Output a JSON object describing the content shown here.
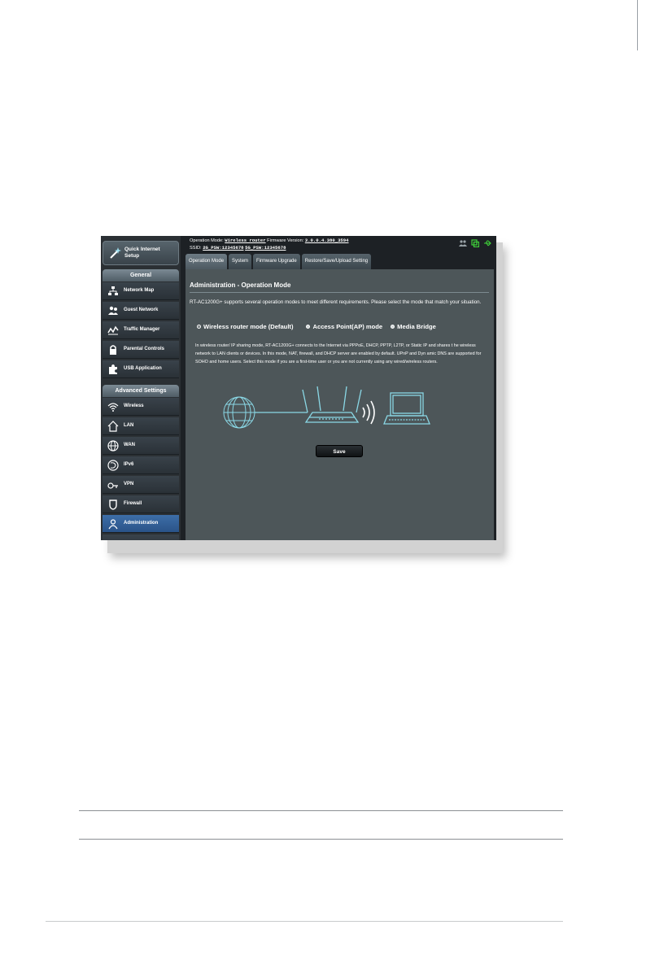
{
  "sidebar": {
    "quick_setup_label": "Quick Internet Setup",
    "general_title": "General",
    "general_items": [
      {
        "label": "Network Map",
        "icon": "network-map-icon"
      },
      {
        "label": "Guest Network",
        "icon": "guest-network-icon"
      },
      {
        "label": "Traffic Manager",
        "icon": "traffic-manager-icon"
      },
      {
        "label": "Parental Controls",
        "icon": "lock-icon"
      },
      {
        "label": "USB Application",
        "icon": "puzzle-icon"
      }
    ],
    "advanced_title": "Advanced Settings",
    "advanced_items": [
      {
        "label": "Wireless",
        "icon": "wifi-icon"
      },
      {
        "label": "LAN",
        "icon": "home-icon"
      },
      {
        "label": "WAN",
        "icon": "globe-icon"
      },
      {
        "label": "IPv6",
        "icon": "ipv6-icon"
      },
      {
        "label": "VPN",
        "icon": "vpn-icon"
      },
      {
        "label": "Firewall",
        "icon": "shield-icon"
      },
      {
        "label": "Administration",
        "icon": "admin-icon"
      }
    ],
    "active_item": "Administration"
  },
  "header": {
    "op_mode_label": "Operation Mode:",
    "op_mode_value": "Wireless router",
    "fw_label": "Firmware Version:",
    "fw_value": "3.0.0.4.380_3594",
    "ssid_label": "SSID:",
    "ssid_2g": "2G_PSW:12345678",
    "ssid_5g": "5G_PSW:12345678"
  },
  "tabs": [
    "Operation Mode",
    "System",
    "Firmware Upgrade",
    "Restore/Save/Upload Setting"
  ],
  "content": {
    "title": "Administration - Operation Mode",
    "description": "RT-AC1200G+ supports several operation modes to meet different requirements. Please select the mode that match your situation.",
    "modes": [
      "Wireless router mode (Default)",
      "Access Point(AP) mode",
      "Media Bridge"
    ],
    "selected_mode": "Wireless router mode (Default)",
    "mode_description": "In wireless router/ IP sharing mode, RT-AC1200G+ connects to the Internet via PPPoE, DHCP, PPTP, L2TP, or Static IP and shares t he wireless network to LAN clients or devices. In this mode, NAT, firewall, and DHCP server are enabled by default. UPnP and Dyn amic DNS are supported for SOHO and home users. Select this mode if you are a first-time user or you are not currently using any wired/wireless routers.",
    "save_label": "Save"
  },
  "colors": {
    "panel_bg": "#4d5659",
    "sidebar_bg": "#2b3034",
    "active_item": "#2a5388",
    "illustration": "#8ad8e6"
  }
}
